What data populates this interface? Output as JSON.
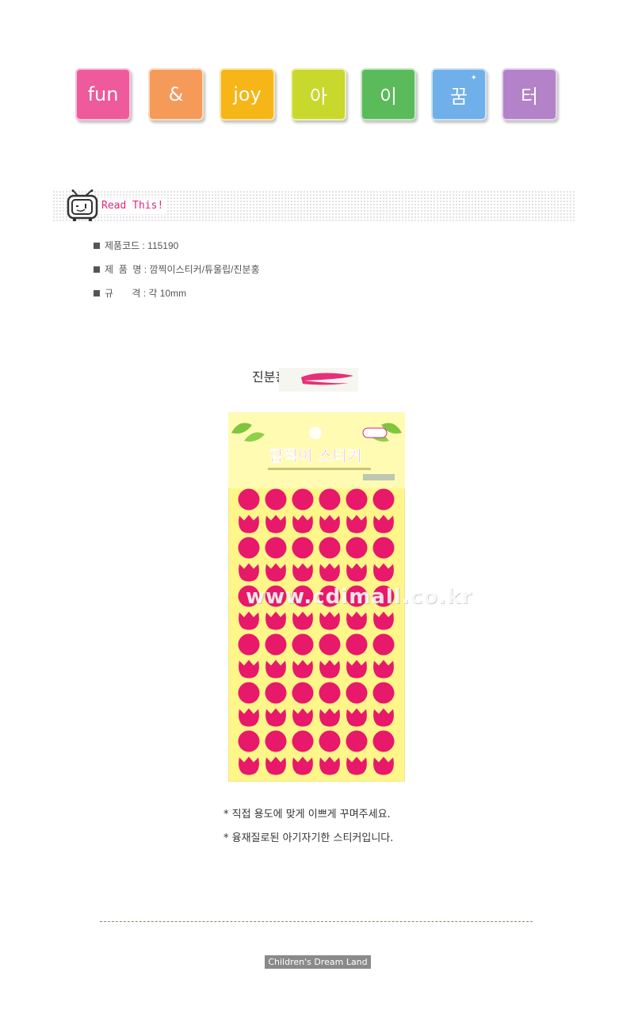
{
  "tiles": [
    {
      "text": "fun",
      "color": "#ee5a9b"
    },
    {
      "text": "&",
      "color": "#f69a5a"
    },
    {
      "text": "joy",
      "color": "#f7b617"
    },
    {
      "text": "아",
      "color": "#c9d82c"
    },
    {
      "text": "이",
      "color": "#5bbb5b"
    },
    {
      "text": "꿈",
      "color": "#6fb0ea"
    },
    {
      "text": "터",
      "color": "#b482c8"
    }
  ],
  "read_this": {
    "title": "Read This!",
    "icon": "tv-icon"
  },
  "info": {
    "code": "제품코드 : 115190",
    "name": "제  품  명 : 깜찍이스티커/튜울립/진분홍",
    "size": "규       격 : 각 10mm"
  },
  "color_label": "진분홍",
  "product": {
    "header_title": "깜찍이 스티커",
    "sticker_color": "#e8186a",
    "sheet_color": "#fff68a",
    "watermark": "www.cdimall.co.kr"
  },
  "notes": [
    "* 직접 용도에 맞게 이쁘게 꾸며주세요.",
    "* 융재질로된 아기자기한 스티커입니다."
  ],
  "footer": "Children's Dream Land"
}
